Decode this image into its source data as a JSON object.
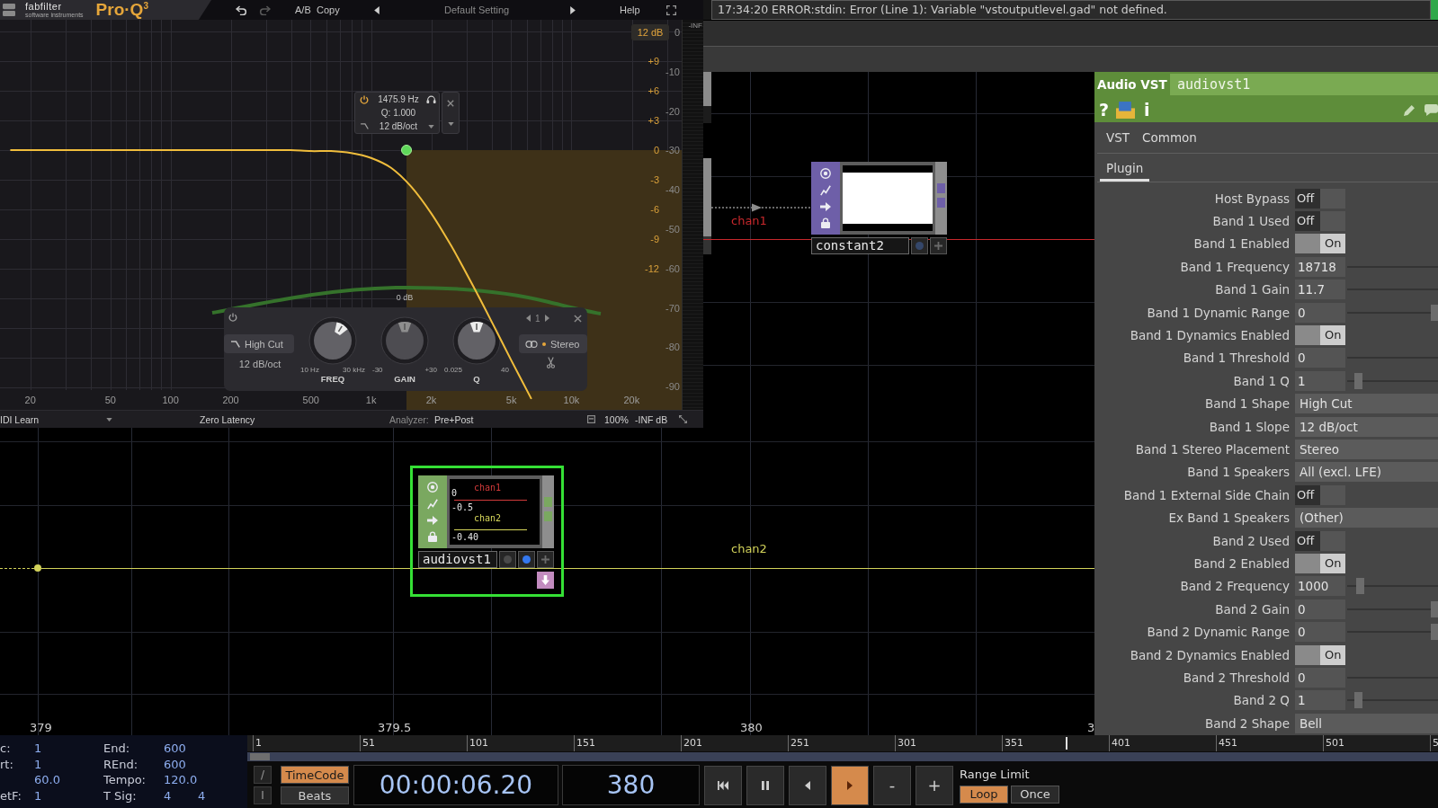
{
  "plugin": {
    "logo": {
      "brand": "fabfilter",
      "tagline": "software instruments",
      "product": "Pro·Q$^{3}$"
    },
    "toolbar": {
      "ab": "A/B",
      "copy": "Copy",
      "preset": "Default Setting",
      "help": "Help"
    },
    "range_button": "12 dB",
    "meter_label": "-INF",
    "analyzer_scale": [
      "0",
      "-10",
      "-20",
      "-30",
      "-40",
      "-50",
      "-60",
      "-70",
      "-80",
      "-90"
    ],
    "chart_data": {
      "type": "line",
      "categories": [
        null,
        "20",
        null,
        null,
        null,
        "50",
        null,
        null,
        "100",
        null,
        null,
        "200",
        null,
        null,
        null,
        "500",
        null,
        null,
        "1k",
        null,
        null,
        "2k",
        null,
        null,
        null,
        "5k",
        null,
        null,
        "10k",
        null,
        null,
        "20k",
        null,
        null
      ],
      "series": [
        {
          "color": "#f0bd3c",
          "values": [
            0,
            0,
            0,
            0,
            0,
            0,
            0,
            0,
            0,
            0,
            0,
            0,
            0,
            0,
            0,
            -0.1,
            -0.1,
            -0.3,
            -0.8,
            -1.8,
            -3.7,
            -6.4,
            -9.7,
            -13.4,
            -17.3,
            -21.3,
            -25.2,
            null,
            null,
            null,
            null,
            null,
            null,
            null
          ]
        }
      ],
      "ylim": [
        -26.3,
        13.2
      ],
      "yticks": [
        {
          "value": 9,
          "label": "+9"
        },
        {
          "value": 6,
          "label": "+6"
        },
        {
          "value": 3,
          "label": "+3"
        },
        0,
        -3,
        -6,
        -9,
        -12
      ],
      "grid": true
    },
    "band_tooltip": {
      "frequency": "1475.9 Hz",
      "q": "Q: 1.000",
      "slope": "12 dB/oct"
    },
    "band_panel": {
      "shape": "High Cut",
      "slope": "12 dB/oct",
      "band": "1",
      "placement": "Stereo",
      "knobs": [
        {
          "label": "FREQ",
          "min": "10 Hz",
          "max": "30 kHz",
          "level": 0.62,
          "disabled": false
        },
        {
          "label": "GAIN",
          "value": "0 dB",
          "min": "-30",
          "max": "+30",
          "level": 0.5,
          "disabled": true
        },
        {
          "label": "Q",
          "min": "0.025",
          "max": "40",
          "level": 0.5,
          "disabled": false
        }
      ]
    },
    "footer": {
      "midi": "IDI Learn",
      "latency": "Zero Latency",
      "analyzer_label": "Analyzer:",
      "analyzer_value": "Pre+Post",
      "zoom": "100%",
      "output": "-INF dB"
    }
  },
  "error_message": "17:34:20 ERROR:stdin: Error (Line 1): Variable \"vstoutputlevel.gad\" not defined.",
  "network": {
    "channels": [
      {
        "label": "chan1",
        "color": "#c8282c"
      },
      {
        "label": "chan2",
        "color": "#d2d25a"
      }
    ],
    "nodes": [
      {
        "name": "constant2",
        "kind": "blank",
        "color": "#6e5fa8",
        "selected": false,
        "flag": false,
        "buttons": [
          {
            "kind": "display",
            "on": false
          },
          {
            "kind": "add"
          }
        ]
      },
      {
        "name": "audiovst1",
        "kind": "chart",
        "color": "#7aa860",
        "selected": true,
        "flag": true,
        "buttons": [
          {
            "kind": "bypass",
            "on": false
          },
          {
            "kind": "display",
            "on": true
          },
          {
            "kind": "add"
          }
        ],
        "viewer": {
          "channels": [
            {
              "label": "chan1",
              "color": "#d23a3a"
            },
            {
              "label": "chan2",
              "color": "#d6d65a"
            }
          ],
          "scale": [
            "0",
            "-0.5",
            "-0.40"
          ]
        }
      }
    ],
    "time_labels": [
      "379",
      "379.5",
      "380",
      "3"
    ]
  },
  "parameters": {
    "type": "Audio VST",
    "name": "audiovst1",
    "help": "?",
    "info": "i",
    "tab_rows": [
      {
        "tabs": [
          {
            "label": "VST",
            "selected": false
          },
          {
            "label": "Common",
            "selected": false
          }
        ]
      },
      {
        "tabs": [
          {
            "label": "Plugin",
            "selected": true
          }
        ]
      }
    ],
    "rows": [
      {
        "label": "Host Bypass",
        "kind": "toggle",
        "value": "Off",
        "on": false
      },
      {
        "label": "Band 1 Used",
        "kind": "toggle",
        "value": "Off",
        "on": false
      },
      {
        "label": "Band 1 Enabled",
        "kind": "toggle",
        "value": "On",
        "on": true
      },
      {
        "label": "Band 1 Frequency",
        "kind": "number",
        "value": "18718"
      },
      {
        "label": "Band 1 Gain",
        "kind": "number",
        "value": "11.7"
      },
      {
        "label": "Band 1 Dynamic Range",
        "kind": "number",
        "value": "0",
        "level": 0.92
      },
      {
        "label": "Band 1 Dynamics Enabled",
        "kind": "toggle",
        "value": "On",
        "on": true
      },
      {
        "label": "Band 1 Threshold",
        "kind": "number",
        "value": "0"
      },
      {
        "label": "Band 1 Q",
        "kind": "number",
        "value": "1",
        "level": 0.08
      },
      {
        "label": "Band 1 Shape",
        "kind": "menu",
        "value": "High Cut"
      },
      {
        "label": "Band 1 Slope",
        "kind": "menu",
        "value": "12 dB/oct"
      },
      {
        "label": "Band 1 Stereo Placement",
        "kind": "menu",
        "value": "Stereo"
      },
      {
        "label": "Band 1 Speakers",
        "kind": "menu",
        "value": "All (excl. LFE)"
      },
      {
        "label": "Band 1 External Side Chain",
        "kind": "toggle",
        "value": "Off",
        "on": false
      },
      {
        "label": "Ex Band 1 Speakers",
        "kind": "menu",
        "value": "(Other)"
      },
      {
        "label": "Band 2 Used",
        "kind": "toggle",
        "value": "Off",
        "on": false
      },
      {
        "label": "Band 2 Enabled",
        "kind": "toggle",
        "value": "On",
        "on": true
      },
      {
        "label": "Band 2 Frequency",
        "kind": "number",
        "value": "1000",
        "level": 0.1
      },
      {
        "label": "Band 2 Gain",
        "kind": "number",
        "value": "0",
        "level": 0.92
      },
      {
        "label": "Band 2 Dynamic Range",
        "kind": "number",
        "value": "0",
        "level": 0.92
      },
      {
        "label": "Band 2 Dynamics Enabled",
        "kind": "toggle",
        "value": "On",
        "on": true
      },
      {
        "label": "Band 2 Threshold",
        "kind": "number",
        "value": "0"
      },
      {
        "label": "Band 2 Q",
        "kind": "number",
        "value": "1",
        "level": 0.08
      },
      {
        "label": "Band 2 Shape",
        "kind": "menu",
        "value": "Bell"
      }
    ]
  },
  "timeline": {
    "info_columns": [
      {
        "fields": [
          {
            "label": "c:",
            "values": [
              "1"
            ]
          },
          {
            "label": "rt:",
            "values": [
              "1"
            ]
          },
          {
            "values": [
              "60.0"
            ]
          },
          {
            "label": "etF:",
            "values": [
              "1"
            ]
          }
        ]
      },
      {
        "fields": [
          {
            "label": "End:",
            "values": [
              "600"
            ]
          },
          {
            "label": "REnd:",
            "values": [
              "600"
            ]
          },
          {
            "label": "Tempo:",
            "values": [
              "120.0"
            ]
          },
          {
            "label": "T Sig:",
            "values": [
              "4",
              "4"
            ]
          }
        ]
      }
    ],
    "ruler": {
      "labels": [
        "1",
        "51",
        "101",
        "151",
        "201",
        "251",
        "301",
        "351",
        "401",
        "451",
        "501",
        "5"
      ],
      "level": 0.687
    },
    "small_buttons": [
      "/",
      "I"
    ],
    "format_buttons": [
      {
        "label": "TimeCode",
        "selected": true
      },
      {
        "label": "Beats",
        "selected": false
      }
    ],
    "timecode": "00:00:06.20",
    "frame": "380",
    "transport": [
      {
        "kind": "to-start",
        "on": false
      },
      {
        "kind": "pause",
        "on": false
      },
      {
        "kind": "reverse",
        "on": false
      },
      {
        "kind": "play",
        "on": true
      },
      {
        "kind": "step",
        "label": "-",
        "on": false
      },
      {
        "kind": "step",
        "label": "+",
        "on": false
      }
    ],
    "range_label": "Range Limit",
    "range_buttons": [
      {
        "label": "Loop",
        "selected": true
      },
      {
        "label": "Once",
        "selected": false
      }
    ]
  }
}
